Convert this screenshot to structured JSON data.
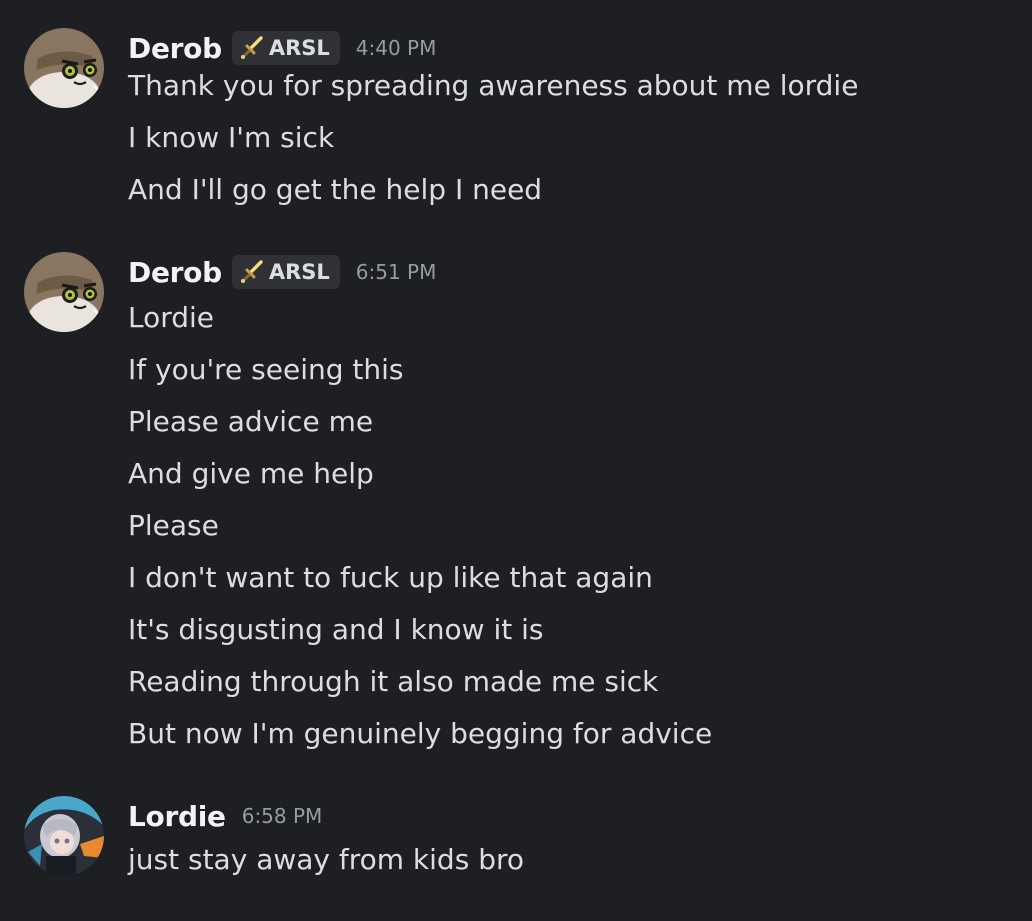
{
  "messages": [
    {
      "author": "Derob",
      "tag": "ARSL",
      "time": "4:40 PM",
      "lines": [
        "Thank you for spreading awareness about me lordie",
        "I know I'm sick",
        "And I'll go get the help I need"
      ]
    },
    {
      "author": "Derob",
      "tag": "ARSL",
      "time": "6:51 PM",
      "lines": [
        "Lordie",
        "If you're seeing this",
        "Please advice me",
        "And give me help",
        "Please",
        "I don't want to fuck up like that again",
        "It's disgusting and I know it is",
        "Reading through it also made me sick",
        "But now I'm genuinely begging for advice"
      ]
    },
    {
      "author": "Lordie",
      "time": "6:58 PM",
      "lines": [
        "just stay away from kids bro"
      ]
    }
  ],
  "colors": {
    "background": "#1e1f22",
    "username": "#f2f3f5",
    "text": "#dbdee1",
    "timestamp": "#949ba4",
    "tag_background": "#2f3136"
  },
  "icons": {
    "tag_icon": "sword-icon",
    "avatar_derob": "owl-avatar",
    "avatar_lordie": "anime-character-avatar"
  }
}
